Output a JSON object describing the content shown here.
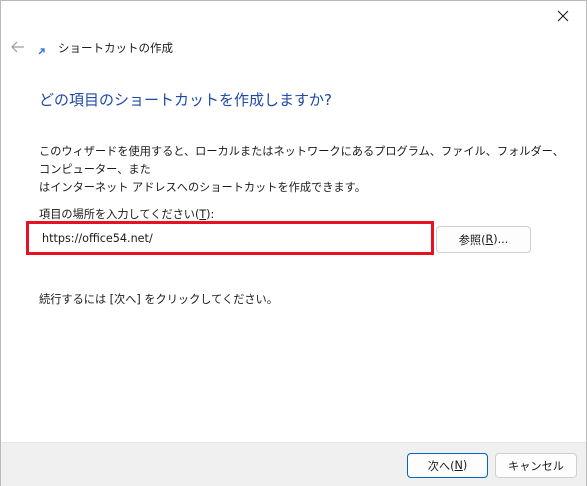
{
  "window": {
    "close_icon": "close-icon"
  },
  "nav": {
    "back_icon": "back-arrow-icon",
    "wizard_icon": "shortcut-arrow-icon",
    "title": "ショートカットの作成"
  },
  "main": {
    "heading": "どの項目のショートカットを作成しますか?",
    "description_line1": "このウィザードを使用すると、ローカルまたはネットワークにあるプログラム、ファイル、フォルダー、コンピューター、また",
    "description_line2": "はインターネット アドレスへのショートカットを作成できます。",
    "field_label_prefix": "項目の場所を入力してください(",
    "field_label_key": "T",
    "field_label_suffix": "):",
    "location_value": "https://office54.net/",
    "browse_prefix": "参照(",
    "browse_key": "R",
    "browse_suffix": ")...",
    "hint": "続行するには [次へ] をクリックしてください。"
  },
  "footer": {
    "next_prefix": "次へ(",
    "next_key": "N",
    "next_suffix": ")",
    "cancel_label": "キャンセル"
  },
  "colors": {
    "heading": "#1f4aa8",
    "highlight": "#e81123",
    "accent": "#0067c0",
    "footer_bg": "#f0f0f0"
  }
}
